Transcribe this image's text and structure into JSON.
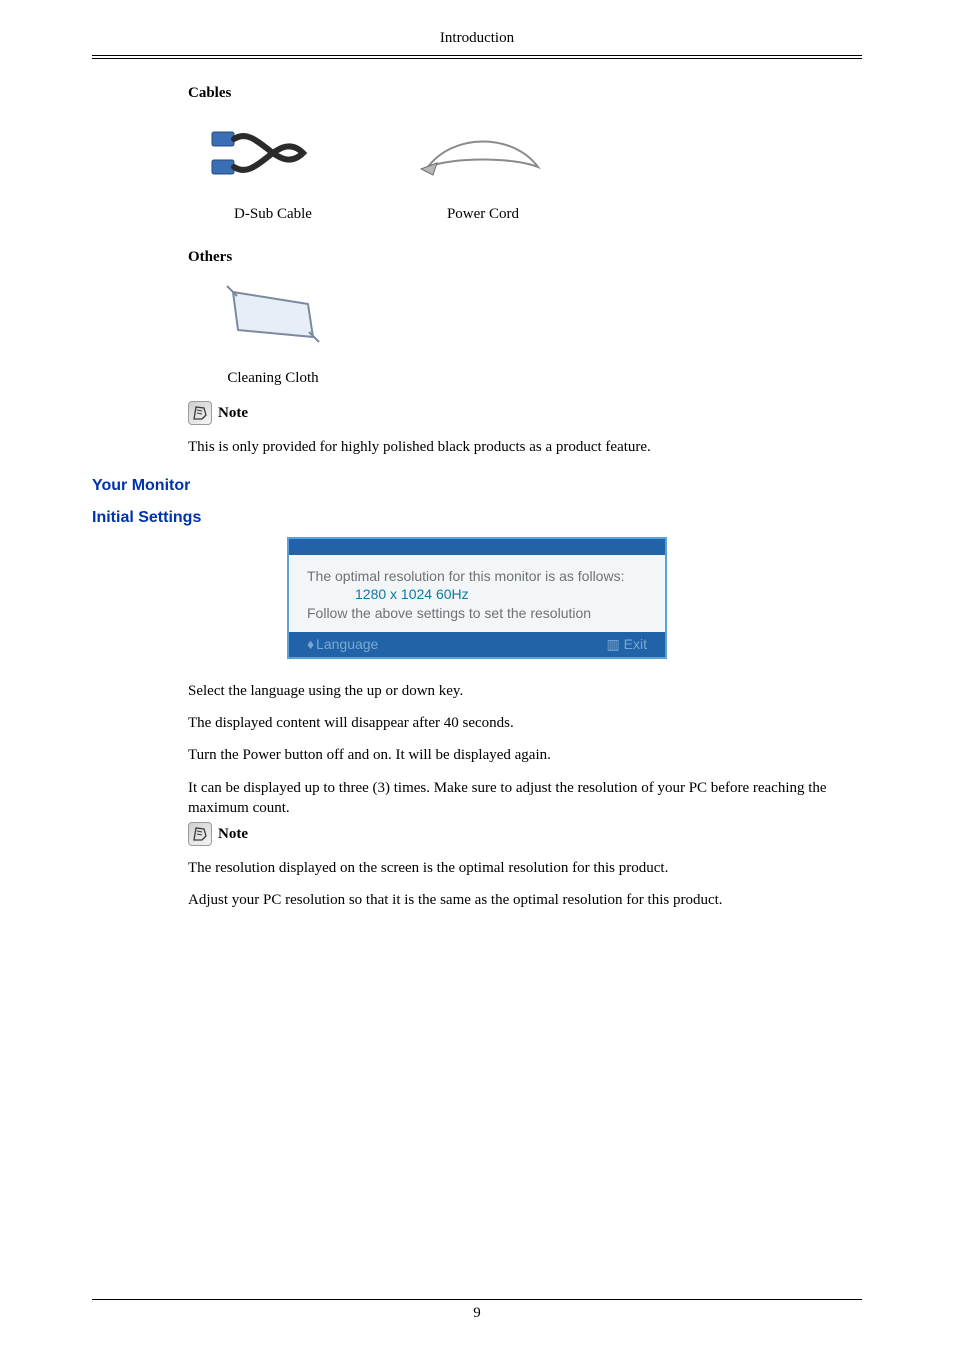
{
  "header": {
    "title": "Introduction"
  },
  "cables": {
    "heading": "Cables",
    "items": [
      {
        "caption": "D-Sub Cable"
      },
      {
        "caption": "Power Cord"
      }
    ]
  },
  "others": {
    "heading": "Others",
    "items": [
      {
        "caption": "Cleaning Cloth"
      }
    ]
  },
  "note1": {
    "label": "Note",
    "text": "This is only provided for highly polished black products as a product feature."
  },
  "sections": {
    "your_monitor": "Your Monitor",
    "initial_settings": "Initial Settings"
  },
  "osd": {
    "line1": "The optimal resolution for this monitor is as follows:",
    "resolution": "1280 x 1024 60Hz",
    "line2": "Follow the above settings to set the resolution",
    "language": "Language",
    "exit": "Exit"
  },
  "body": {
    "p1": "Select the language using the up or down key.",
    "p2": "The displayed content will disappear after 40 seconds.",
    "p3": "Turn the Power button off and on. It will be displayed again.",
    "p4": "It can be displayed up to three (3) times. Make sure to adjust the resolution of your PC before reaching the maximum count."
  },
  "note2": {
    "label": "Note",
    "p1": "The resolution displayed on the screen is the optimal resolution for this product.",
    "p2": "Adjust your PC resolution so that it is the same as the optimal resolution for this product."
  },
  "footer": {
    "page_number": "9"
  }
}
